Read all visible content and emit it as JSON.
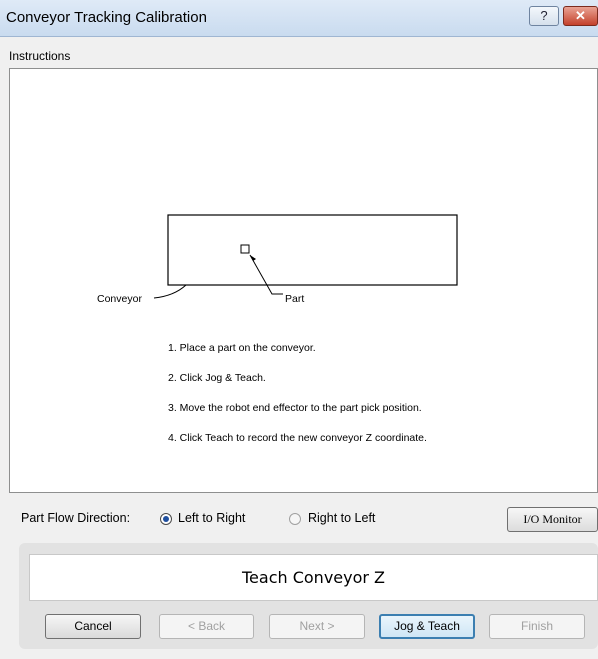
{
  "window": {
    "title": "Conveyor Tracking Calibration",
    "help_label": "?",
    "close_label": "✕"
  },
  "instructions": {
    "group_label": "Instructions",
    "diagram": {
      "conveyor_label": "Conveyor",
      "part_label": "Part"
    },
    "steps": [
      "1. Place a part on the conveyor.",
      "2. Click Jog & Teach.",
      "3. Move the robot end effector to the part pick position.",
      "4. Click Teach to record the new conveyor Z coordinate."
    ]
  },
  "part_flow": {
    "label": "Part Flow Direction:",
    "options": [
      {
        "label": "Left to Right",
        "selected": true
      },
      {
        "label": "Right to Left",
        "selected": false
      }
    ],
    "io_monitor_label": "I/O Monitor"
  },
  "step_title": "Teach Conveyor Z",
  "buttons": {
    "cancel": "Cancel",
    "back": "< Back",
    "next": "Next >",
    "jog_teach": "Jog & Teach",
    "finish": "Finish"
  },
  "colors": {
    "radio_selected": "#1f4f9f",
    "default_button_border": "#3c7fb1",
    "close_button": "#c4412b"
  }
}
